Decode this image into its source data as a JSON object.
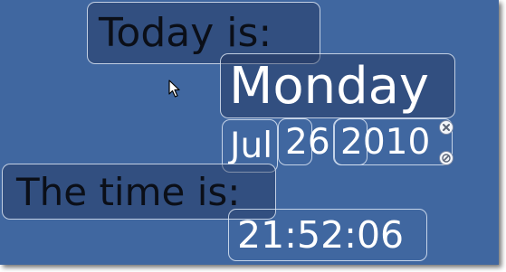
{
  "today": {
    "label": "Today is:",
    "day": "Monday",
    "month": "Jul",
    "date": "26",
    "year": "2010"
  },
  "time": {
    "label": "The time is:",
    "value": "21:52:06"
  },
  "controls": {
    "close_icon": "close-icon",
    "resize_icon": "resize-icon"
  },
  "colors": {
    "background": "#4067a0",
    "label_text": "#0b0f18",
    "value_text": "#ffffff"
  }
}
